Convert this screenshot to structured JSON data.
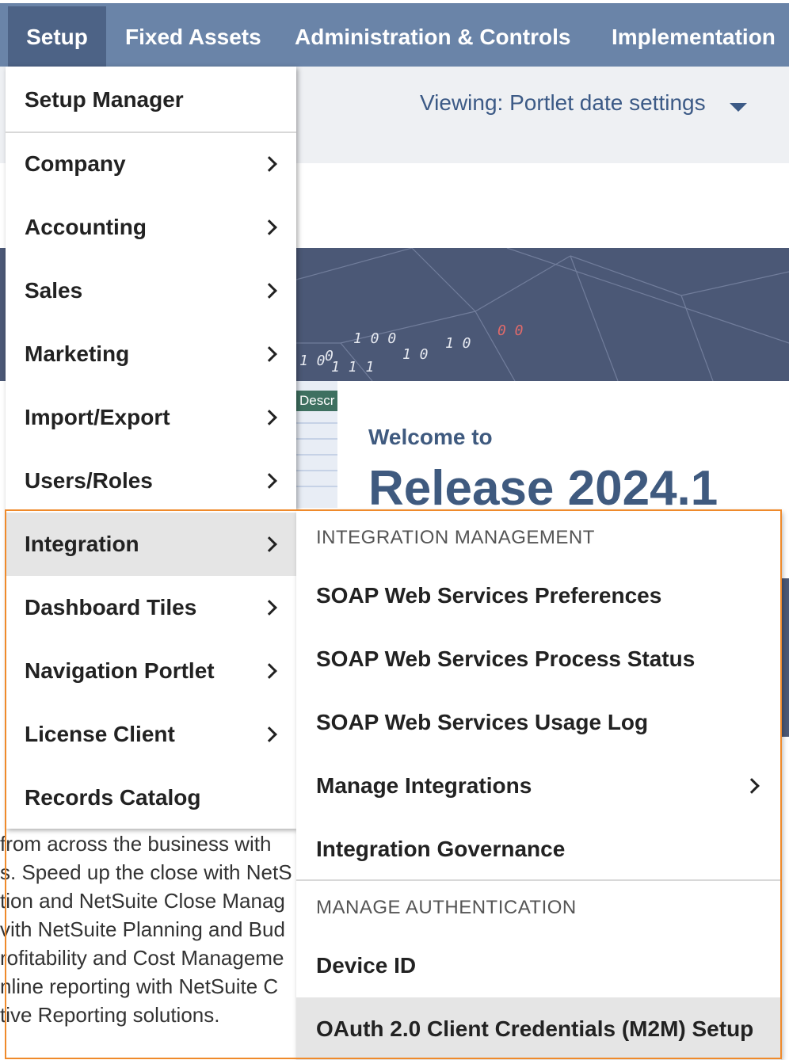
{
  "topnav": {
    "tabs": [
      {
        "label": "Setup"
      },
      {
        "label": "Fixed Assets"
      },
      {
        "label": "Administration & Controls"
      },
      {
        "label": "Implementation"
      }
    ]
  },
  "subheader": {
    "viewing": "Viewing: Portlet date settings"
  },
  "banner": {
    "binary": [
      "1 0",
      "0",
      "1 0 0",
      "1 1 1",
      "1 0",
      "1 0",
      "0 0"
    ],
    "desc_tag": "Descr"
  },
  "welcome": {
    "small": "Welcome to",
    "big": "Release 2024.1"
  },
  "background_text": [
    "from across the business with",
    "s. Speed up the close with NetS",
    "tion and NetSuite Close Manag",
    "vith NetSuite Planning and Bud",
    "rofitability and Cost Manageme",
    "nline reporting with NetSuite C",
    "tive Reporting solutions."
  ],
  "menu": {
    "items": [
      {
        "label": "Setup Manager"
      },
      {
        "label": "Company"
      },
      {
        "label": "Accounting"
      },
      {
        "label": "Sales"
      },
      {
        "label": "Marketing"
      },
      {
        "label": "Import/Export"
      },
      {
        "label": "Users/Roles"
      },
      {
        "label": "Integration"
      },
      {
        "label": "Dashboard Tiles"
      },
      {
        "label": "Navigation Portlet"
      },
      {
        "label": "License Client"
      },
      {
        "label": "Records Catalog"
      }
    ]
  },
  "submenu": {
    "section1": "INTEGRATION MANAGEMENT",
    "items1": [
      {
        "label": "SOAP Web Services Preferences"
      },
      {
        "label": "SOAP Web Services Process Status"
      },
      {
        "label": "SOAP Web Services Usage Log"
      },
      {
        "label": "Manage Integrations"
      },
      {
        "label": "Integration Governance"
      }
    ],
    "section2": "MANAGE AUTHENTICATION",
    "items2": [
      {
        "label": "Device ID"
      },
      {
        "label": "OAuth 2.0 Client Credentials (M2M) Setup"
      }
    ]
  },
  "colors": {
    "nav": "#6a84a8",
    "nav_active": "#4d6386",
    "highlight": "#ef8a2b",
    "brand_text": "#3f5a7f"
  }
}
